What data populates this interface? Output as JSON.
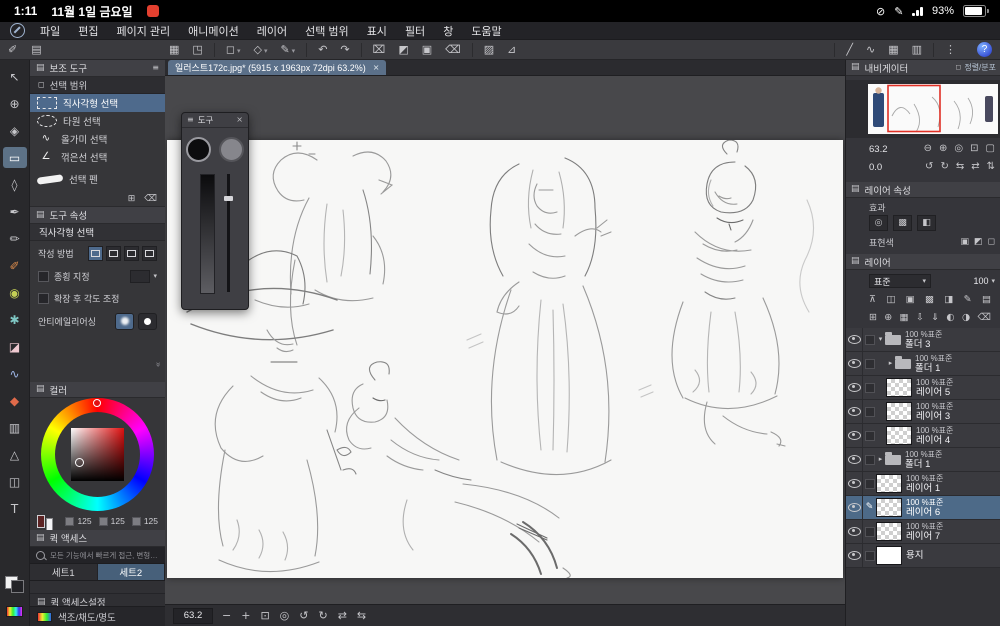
{
  "icons": {
    "menu": "≡",
    "dropdown": "▾",
    "close": "×",
    "chevron": "»",
    "dnd": "⊘",
    "pencil": "✎",
    "trash": "⌫",
    "add_box": "⊞",
    "panel_grid": "▤",
    "selection": "◻",
    "gear": "⚙",
    "dots": "⋮"
  },
  "status_bar": {
    "time": "1:11",
    "date": "11월 1일 금요일",
    "battery_percent": "93%"
  },
  "menu_bar": {
    "items": [
      "파일",
      "편집",
      "페이지 관리",
      "애니메이션",
      "레이어",
      "선택 범위",
      "표시",
      "필터",
      "창",
      "도움말"
    ]
  },
  "toolbar": {
    "left_icons": [
      {
        "name": "brush-settings-icon",
        "glyph": "✐"
      },
      {
        "name": "workspace-layout-icon",
        "glyph": "▤"
      }
    ],
    "groups": [
      {
        "icons": [
          {
            "name": "canvas-settings-icon",
            "glyph": "▦"
          },
          {
            "name": "rotate-view-icon",
            "glyph": "◳"
          }
        ]
      },
      {
        "icons": [
          {
            "name": "selection-rect-icon",
            "glyph": "◻",
            "dropdown": true
          },
          {
            "name": "selection-lasso-icon",
            "glyph": "◇",
            "dropdown": true
          },
          {
            "name": "selection-pen-icon",
            "glyph": "✎",
            "dropdown": true
          }
        ]
      },
      {
        "icons": [
          {
            "name": "undo-icon",
            "glyph": "↶"
          },
          {
            "name": "redo-icon",
            "glyph": "↷"
          }
        ]
      },
      {
        "icons": [
          {
            "name": "deselect-icon",
            "glyph": "⌧"
          },
          {
            "name": "invert-selection-icon",
            "glyph": "◩"
          },
          {
            "name": "select-all-icon",
            "glyph": "▣"
          },
          {
            "name": "clear-icon",
            "glyph": "⌫"
          }
        ]
      },
      {
        "icons": [
          {
            "name": "fill-selection-icon",
            "glyph": "▨"
          },
          {
            "name": "transform-icon",
            "glyph": "⊿"
          }
        ]
      },
      {
        "spacer": true,
        "icons": []
      },
      {
        "icons": [
          {
            "name": "ruler-icon",
            "glyph": "╱"
          },
          {
            "name": "curve-ruler-icon",
            "glyph": "∿"
          },
          {
            "name": "grid-icon",
            "glyph": "▦"
          },
          {
            "name": "material-palette-icon",
            "glyph": "▥"
          }
        ]
      },
      {
        "icons": [
          {
            "name": "more-options-icon",
            "glyph": "⋮"
          }
        ]
      }
    ],
    "help_label": "?"
  },
  "tool_strip": {
    "tools": [
      {
        "name": "operation-tool",
        "glyph": "↖"
      },
      {
        "name": "move-tool",
        "glyph": "⊕"
      },
      {
        "name": "layer-move-tool",
        "glyph": "◈"
      },
      {
        "name": "selection-tool",
        "glyph": "▭",
        "selected": true
      },
      {
        "name": "eyedropper-tool",
        "glyph": "◊"
      },
      {
        "name": "pen-tool",
        "glyph": "✒"
      },
      {
        "name": "pencil-tool",
        "glyph": "✏"
      },
      {
        "name": "brush-tool",
        "glyph": "✐",
        "color": "#dd8d4d"
      },
      {
        "name": "airbrush-tool",
        "glyph": "◉",
        "color": "#c3cf56"
      },
      {
        "name": "decoration-tool",
        "glyph": "✱",
        "color": "#7fc7c4"
      },
      {
        "name": "eraser-tool",
        "glyph": "◪",
        "color": "#efc9d1"
      },
      {
        "name": "blend-tool",
        "glyph": "∿",
        "color": "#9fb7e8"
      },
      {
        "name": "fill-tool",
        "glyph": "◆",
        "color": "#e06a4a"
      },
      {
        "name": "gradient-tool",
        "glyph": "▥"
      },
      {
        "name": "figure-tool",
        "glyph": "△"
      },
      {
        "name": "frame-tool",
        "glyph": "◫"
      },
      {
        "name": "text-tool",
        "glyph": "T"
      }
    ]
  },
  "subtool_panel": {
    "title": "보조 도구",
    "group_label": "선택 범위",
    "tools": [
      {
        "label": "직사각형 선택",
        "type": "rect",
        "selected": true
      },
      {
        "label": "타원 선택",
        "type": "ellipse"
      },
      {
        "label": "올가미 선택",
        "type": "lasso",
        "glyph": "∿"
      },
      {
        "label": "꺾은선 선택",
        "type": "poly",
        "glyph": "∠"
      },
      {
        "label": "선택 펜",
        "type": "pen"
      }
    ]
  },
  "tool_property_panel": {
    "title": "도구 속성",
    "tool_name": "직사각형 선택",
    "method_label": "작성 방법",
    "aspect_label": "종횡 지정",
    "angle_label": "확장 후 각도 조정",
    "aa_label": "안티에일리어싱"
  },
  "color_panel": {
    "title": "컬러",
    "current_color": "#5c2323",
    "rgb_values": [
      "125",
      "125",
      "125"
    ]
  },
  "quick_access_panel": {
    "title": "퀵 액세스",
    "search_placeholder": "모든 기능에서 빠르게 접근, 변형, 등록",
    "tabs": [
      {
        "label": "세트1"
      },
      {
        "label": "세트2",
        "selected": true
      }
    ],
    "settings_label": "퀵 액세스설정"
  },
  "hsv_bar": {
    "label": "색조/채도/명도"
  },
  "canvas": {
    "tab_title": "일러스트172c.jpg* (5915 x 1963px 72dpi 63.2%)"
  },
  "floating_tool_panel": {
    "title": "도구"
  },
  "navigator_panel": {
    "title": "내비게이터",
    "dock_label": "정렬/분포",
    "zoom_value": "63.2",
    "rotate_value": "0.0",
    "zoom_icons": [
      {
        "name": "zoom-out-icon",
        "glyph": "⊖"
      },
      {
        "name": "zoom-in-icon",
        "glyph": "⊕"
      },
      {
        "name": "zoom-reset-icon",
        "glyph": "◎"
      },
      {
        "name": "fit-screen-icon",
        "glyph": "⊡"
      },
      {
        "name": "actual-size-icon",
        "glyph": "▢"
      }
    ],
    "rotate_icons": [
      {
        "name": "rotate-left-icon",
        "glyph": "↺"
      },
      {
        "name": "rotate-right-icon",
        "glyph": "↻"
      },
      {
        "name": "reset-rotation-icon",
        "glyph": "⇆"
      },
      {
        "name": "flip-horizontal-icon",
        "glyph": "⇄"
      },
      {
        "name": "flip-vertical-icon",
        "glyph": "⇅"
      }
    ]
  },
  "layer_property_panel": {
    "title": "레이어 속성",
    "effect_label": "효과",
    "effect_icons": [
      {
        "name": "border-effect-icon",
        "glyph": "◎"
      },
      {
        "name": "tone-effect-icon",
        "glyph": "▩"
      },
      {
        "name": "layer-color-icon",
        "glyph": "◧"
      }
    ],
    "expression_label": "표현색",
    "expression_icons": [
      {
        "name": "color-mode-icon",
        "glyph": "▣"
      },
      {
        "name": "gray-mode-icon",
        "glyph": "◩"
      },
      {
        "name": "mono-mode-icon",
        "glyph": "◻"
      }
    ]
  },
  "layer_panel": {
    "title": "레이어",
    "blend_mode": "표준",
    "opacity_value": "100",
    "lock_icons": [
      {
        "name": "clip-below-icon",
        "glyph": "⊼"
      },
      {
        "name": "reference-layer-icon",
        "glyph": "◫"
      },
      {
        "name": "lock-layer-icon",
        "glyph": "▣"
      },
      {
        "name": "lock-transparent-icon",
        "glyph": "▩"
      },
      {
        "name": "enable-mask-icon",
        "glyph": "◨"
      },
      {
        "name": "draft-layer-icon",
        "glyph": "✎"
      },
      {
        "name": "ruler-range-icon",
        "glyph": "▤"
      }
    ],
    "action_icons": [
      {
        "name": "new-layer-icon",
        "glyph": "⊞"
      },
      {
        "name": "new-vector-layer-icon",
        "glyph": "⊕"
      },
      {
        "name": "new-folder-icon",
        "glyph": "▦"
      },
      {
        "name": "transfer-down-icon",
        "glyph": "⇩"
      },
      {
        "name": "merge-down-icon",
        "glyph": "⇓"
      },
      {
        "name": "create-mask-icon",
        "glyph": "◐"
      },
      {
        "name": "apply-mask-icon",
        "glyph": "◑"
      },
      {
        "name": "delete-layer-icon",
        "glyph": "⌫"
      }
    ],
    "layers": [
      {
        "info": "100 %표준",
        "name": "폴더 3",
        "type": "folder",
        "arrow": "▾",
        "eye": true
      },
      {
        "info": "100 %표준",
        "name": "폴더 1",
        "type": "folder",
        "arrow": "▸",
        "indent": 1,
        "eye": true
      },
      {
        "info": "100 %표준",
        "name": "레이어 5",
        "type": "layer",
        "indent": 1,
        "eye": true
      },
      {
        "info": "100 %표준",
        "name": "레이어 3",
        "type": "layer",
        "indent": 1,
        "eye": true
      },
      {
        "info": "100 %표준",
        "name": "레이어 4",
        "type": "layer",
        "indent": 1,
        "eye": true
      },
      {
        "info": "100 %표준",
        "name": "폴더 1",
        "type": "folder",
        "arrow": "▸",
        "eye": true
      },
      {
        "info": "100 %표준",
        "name": "레이어 1",
        "type": "layer",
        "eye": true
      },
      {
        "info": "100 %표준",
        "name": "레이어 6",
        "type": "layer",
        "selected": true,
        "editing": true,
        "eye": true
      },
      {
        "info": "100 %표준",
        "name": "레이어 7",
        "type": "layer",
        "eye": true
      },
      {
        "name": "용지",
        "type": "paper",
        "eye": true
      }
    ]
  },
  "bottom_bar": {
    "zoom_value": "63.2",
    "icons": [
      {
        "name": "zoom-out-icon",
        "glyph": "−"
      },
      {
        "name": "zoom-in-icon",
        "glyph": "+"
      },
      {
        "name": "fit-screen-icon",
        "glyph": "⊡"
      },
      {
        "name": "actual-size-icon",
        "glyph": "◎"
      },
      {
        "name": "rotate-left-icon",
        "glyph": "↺"
      },
      {
        "name": "rotate-right-icon",
        "glyph": "↻"
      },
      {
        "name": "flip-horizontal-icon",
        "glyph": "⇄"
      },
      {
        "name": "reset-view-icon",
        "glyph": "⇆"
      }
    ]
  }
}
